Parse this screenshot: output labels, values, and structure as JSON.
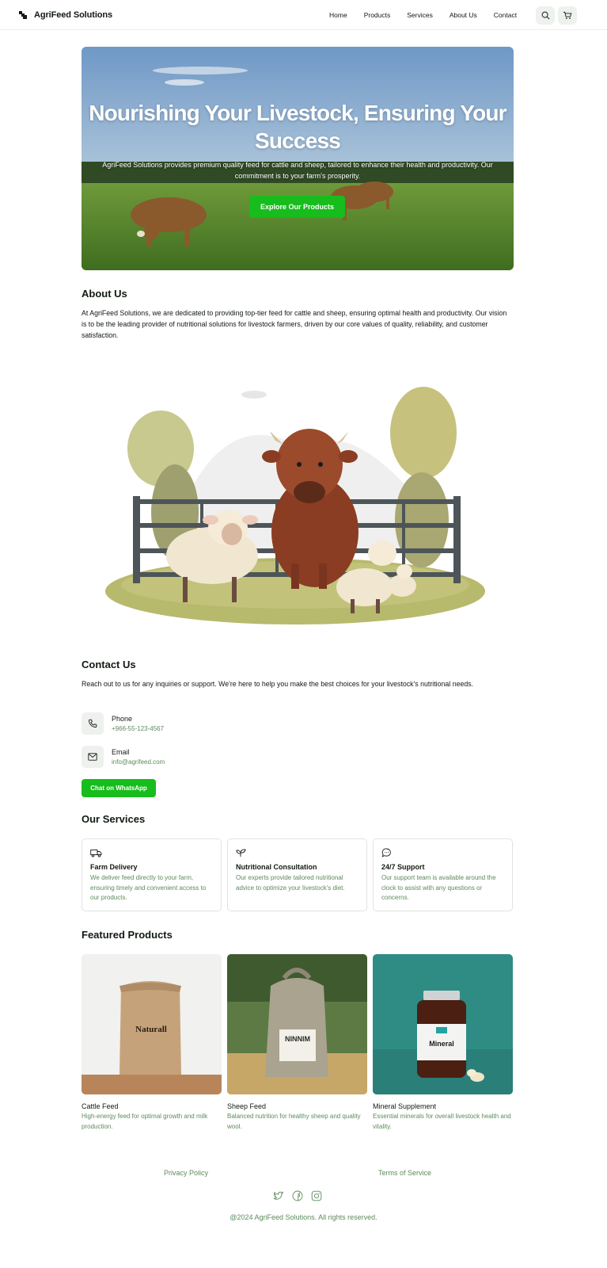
{
  "brand": {
    "name": "AgriFeed Solutions"
  },
  "nav": {
    "items": [
      "Home",
      "Products",
      "Services",
      "About Us",
      "Contact"
    ]
  },
  "header_icons": [
    "search-icon",
    "cart-icon"
  ],
  "hero": {
    "title": "Nourishing Your Livestock, Ensuring Your Success",
    "subtitle": "AgriFeed Solutions provides premium quality feed for cattle and sheep, tailored to enhance their health and productivity. Our commitment is to your farm's prosperity.",
    "cta": "Explore Our Products"
  },
  "about": {
    "title": "About Us",
    "text": "At AgriFeed Solutions, we are dedicated to providing top-tier feed for cattle and sheep, ensuring optimal health and productivity. Our vision is to be the leading provider of nutritional solutions for livestock farmers, driven by our core values of quality, reliability, and customer satisfaction."
  },
  "contact": {
    "title": "Contact Us",
    "text": "Reach out to us for any inquiries or support. We're here to help you make the best choices for your livestock's nutritional needs.",
    "phone_label": "Phone",
    "phone_value": "+966-55-123-4567",
    "email_label": "Email",
    "email_value": "info@agrifeed.com",
    "whatsapp": "Chat on WhatsApp"
  },
  "services": {
    "title": "Our Services",
    "items": [
      {
        "icon": "truck-icon",
        "title": "Farm Delivery",
        "desc": "We deliver feed directly to your farm, ensuring timely and convenient access to our products."
      },
      {
        "icon": "sprout-icon",
        "title": "Nutritional Consultation",
        "desc": "Our experts provide tailored nutritional advice to optimize your livestock's diet."
      },
      {
        "icon": "chat-icon",
        "title": "24/7 Support",
        "desc": "Our support team is available around the clock to assist with any questions or concerns."
      }
    ]
  },
  "products": {
    "title": "Featured Products",
    "items": [
      {
        "name": "Cattle Feed",
        "desc": "High-energy feed for optimal growth and milk production.",
        "label": "Naturall"
      },
      {
        "name": "Sheep Feed",
        "desc": "Balanced nutrition for healthy sheep and quality wool.",
        "label": "NINNIM"
      },
      {
        "name": "Mineral Supplement",
        "desc": "Essential minerals for overall livestock health and vitality.",
        "label": "Mineral"
      }
    ]
  },
  "footer": {
    "privacy": "Privacy Policy",
    "terms": "Terms of Service",
    "social_icons": [
      "twitter-icon",
      "facebook-icon",
      "instagram-icon"
    ],
    "copyright": "@2024 AgriFeed Solutions. All rights reserved."
  },
  "colors": {
    "accent": "#17bd1c",
    "muted_text": "#5c8a5c",
    "chip_bg": "#eef1ee"
  }
}
